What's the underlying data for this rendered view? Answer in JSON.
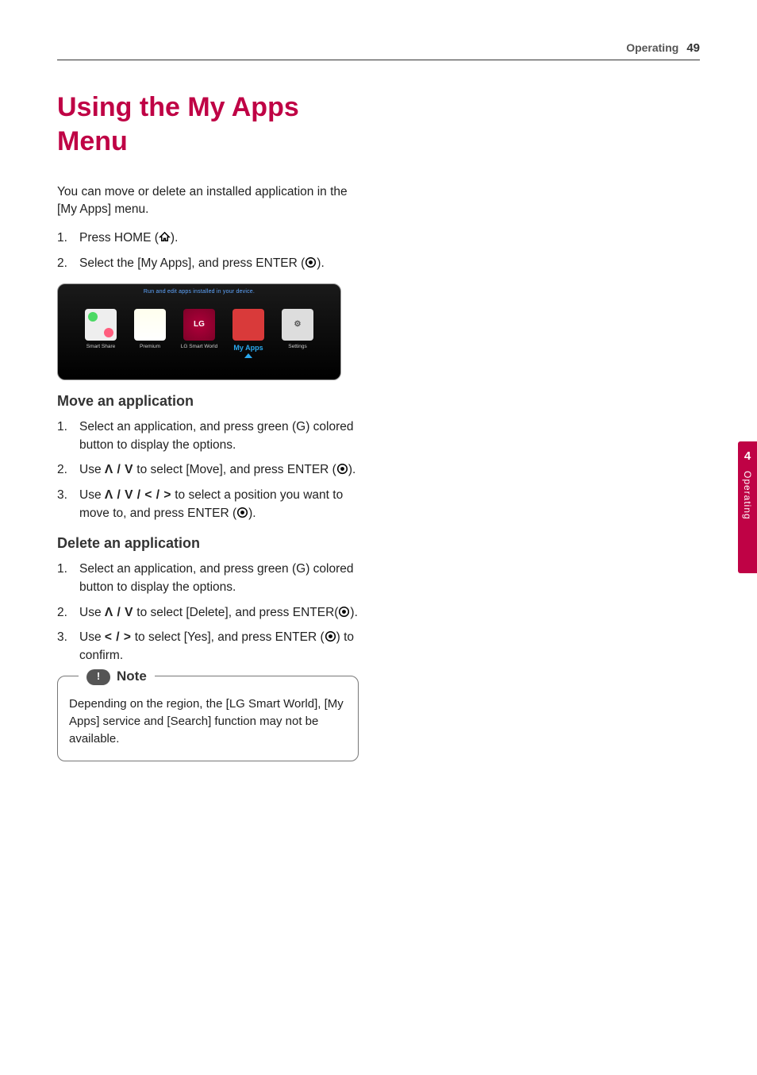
{
  "header": {
    "section": "Operating",
    "page": "49"
  },
  "side": {
    "chapter": "4",
    "name": "Operating"
  },
  "title": "Using the My Apps Menu",
  "intro": "You can move or delete an installed application in the [My Apps] menu.",
  "initial_steps": [
    {
      "num": "1.",
      "pre": "Press HOME (",
      "post": ")."
    },
    {
      "num": "2.",
      "pre": "Select the [My Apps], and press ENTER (",
      "post": ")."
    }
  ],
  "screenshot": {
    "banner": "Run and edit apps installed in your device.",
    "tiles": [
      {
        "label": "Smart Share"
      },
      {
        "label": "Premium"
      },
      {
        "label": "LG Smart World",
        "lg": true
      },
      {
        "label": "My Apps",
        "highlight": true
      },
      {
        "label": "Settings"
      }
    ]
  },
  "move": {
    "heading": "Move an application",
    "steps": [
      {
        "num": "1.",
        "text": "Select an application, and press green (G) colored button to display the options."
      },
      {
        "num": "2.",
        "pre": "Use ",
        "sym": "Λ / V",
        "mid": " to select [Move], and press ENTER (",
        "post": ")."
      },
      {
        "num": "3.",
        "pre": "Use ",
        "sym": "Λ / V / < / >",
        "mid": " to select a position you want to move to, and press ENTER (",
        "post": ")."
      }
    ]
  },
  "delete": {
    "heading": "Delete an application",
    "steps": [
      {
        "num": "1.",
        "text": "Select an application, and press green (G) colored button to display the options."
      },
      {
        "num": "2.",
        "pre": "Use ",
        "sym": "Λ / V",
        "mid": " to select [Delete], and press ENTER(",
        "post": ")."
      },
      {
        "num": "3.",
        "pre": "Use ",
        "sym": "< / >",
        "mid": " to select [Yes], and press ENTER (",
        "post": ") to confirm."
      }
    ]
  },
  "note": {
    "label": "Note",
    "body": "Depending on the region, the [LG Smart World], [My Apps] service and [Search] function may not be available."
  }
}
